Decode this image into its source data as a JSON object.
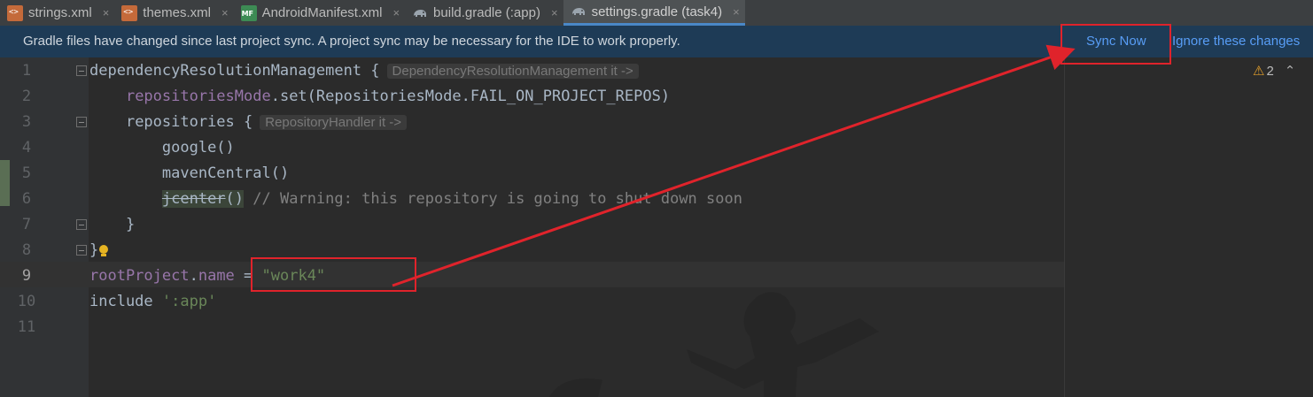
{
  "tabs": [
    {
      "label": "strings.xml",
      "icon": "xml-file-icon"
    },
    {
      "label": "themes.xml",
      "icon": "xml-file-icon"
    },
    {
      "label": "AndroidManifest.xml",
      "icon": "manifest-file-icon"
    },
    {
      "label": "build.gradle (:app)",
      "icon": "gradle-elephant-icon"
    },
    {
      "label": "settings.gradle (task4)",
      "icon": "gradle-elephant-icon",
      "active": true
    }
  ],
  "tab_close_glyph": "×",
  "banner": {
    "message": "Gradle files have changed since last project sync. A project sync may be necessary for the IDE to work properly.",
    "sync_now": "Sync Now",
    "ignore": "Ignore these changes"
  },
  "inspections": {
    "warning_count": "2"
  },
  "line_numbers": [
    "1",
    "2",
    "3",
    "4",
    "5",
    "6",
    "7",
    "8",
    "9",
    "10",
    "11"
  ],
  "code": {
    "l1_keyword": "dependencyResolutionManagement {",
    "l1_hint": "DependencyResolutionManagement it ->",
    "l2_prop": "repositoriesMode",
    "l2_rest": ".set(RepositoriesMode.FAIL_ON_PROJECT_REPOS)",
    "l3_keyword": "repositories {",
    "l3_hint": "RepositoryHandler it ->",
    "l4": "google()",
    "l5": "mavenCentral()",
    "l6_deprecated": "jcenter",
    "l6_parens": "()",
    "l6_comment": "// Warning: this repository is going to shut down soon",
    "l7": "}",
    "l8": "}",
    "l9_obj": "rootProject",
    "l9_dot": ".",
    "l9_prop": "name",
    "l9_eq": " = ",
    "l9_value": "\"work4\"",
    "l10_keyword": "include ",
    "l10_value": "':app'"
  },
  "colors": {
    "banner_bg": "#1e3b56",
    "link": "#589df6",
    "annotation_red": "#e0232b",
    "string_green": "#6a8759",
    "property_purple": "#9876aa"
  }
}
